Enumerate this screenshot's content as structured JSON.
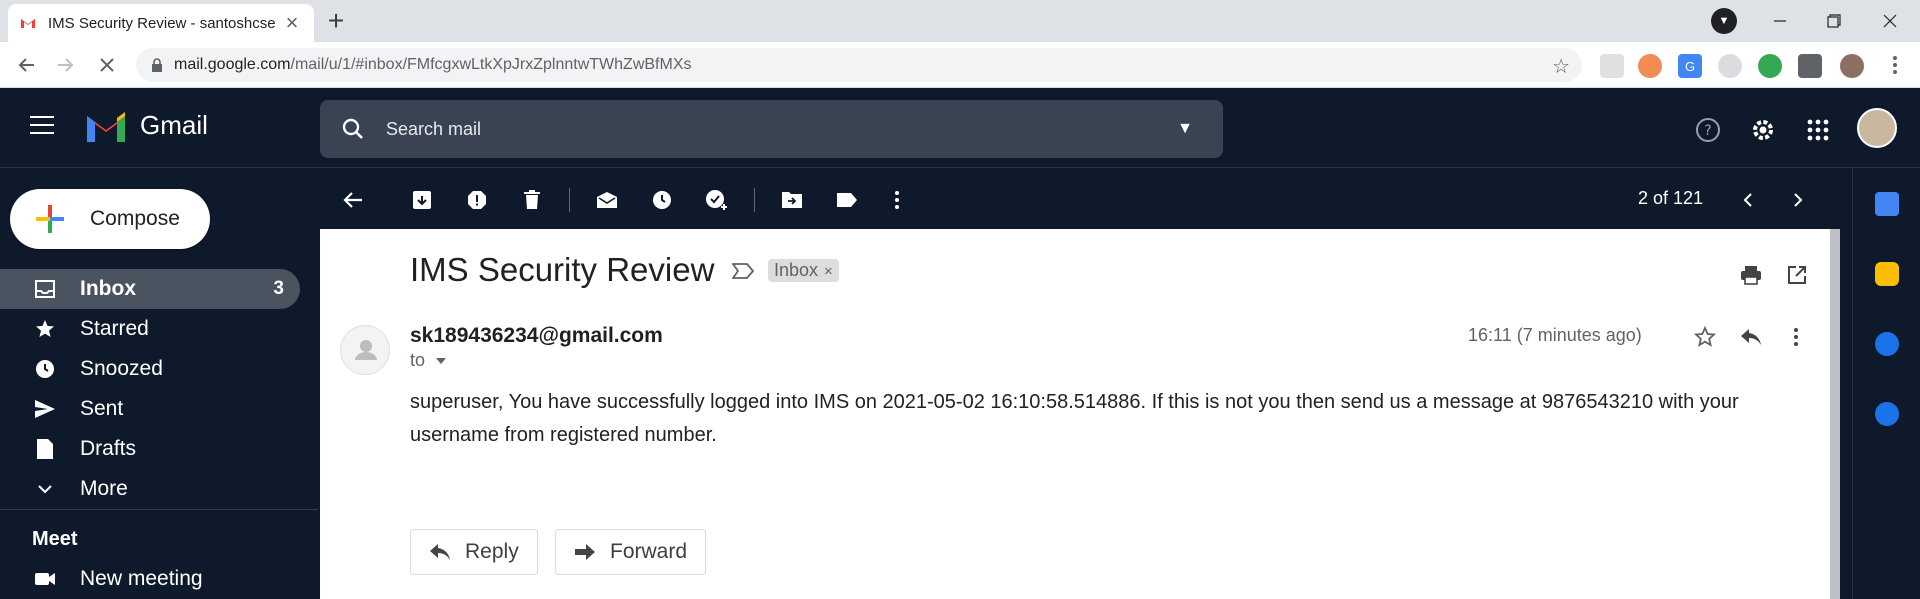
{
  "browser": {
    "tab_title": "IMS Security Review - santoshcse",
    "tab_close": "×",
    "new_tab": "+",
    "url_main": "mail.google.com",
    "url_rest": "/mail/u/1/#inbox/FMfcgxwLtkXpJrxZplnntwTWhZwBfMXs"
  },
  "gmail": {
    "logo_text": "Gmail",
    "search_placeholder": "Search mail",
    "compose_label": "Compose",
    "nav": [
      {
        "label": "Inbox",
        "count": "3"
      },
      {
        "label": "Starred",
        "count": ""
      },
      {
        "label": "Snoozed",
        "count": ""
      },
      {
        "label": "Sent",
        "count": ""
      },
      {
        "label": "Drafts",
        "count": ""
      },
      {
        "label": "More",
        "count": ""
      }
    ],
    "meet_title": "Meet",
    "meet_items": [
      {
        "label": "New meeting"
      }
    ],
    "pager": "2 of 121"
  },
  "message": {
    "subject": "IMS Security Review",
    "label_chip": "Inbox",
    "label_chip_close": "×",
    "sender": "sk189436234@gmail.com",
    "to": "to",
    "time": "16:11 (7 minutes ago)",
    "body": " superuser, You have successfully logged into IMS on 2021-05-02 16:10:58.514886. If this is not you then send us a message at 9876543210 with your username from registered number.",
    "reply_label": "Reply",
    "forward_label": "Forward"
  },
  "colors": {
    "background": "#0e1a2b",
    "active_nav": "rgba(255,255,255,0.25)",
    "gmail_red": "#EA4335",
    "gmail_blue": "#4285F4",
    "gmail_green": "#34A853",
    "gmail_yellow": "#FBBC04"
  }
}
